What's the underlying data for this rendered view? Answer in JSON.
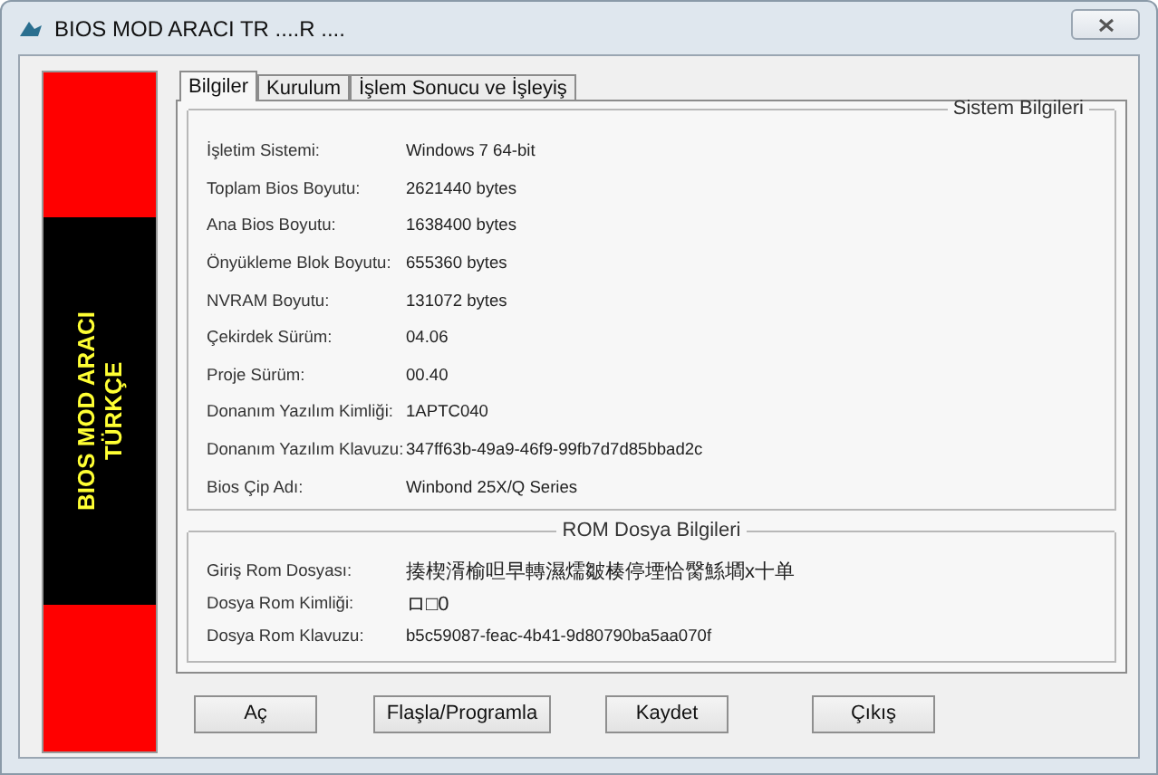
{
  "window": {
    "title": "BIOS MOD ARACI TR ....R ...."
  },
  "banner": {
    "lines": [
      "BIOS MOD ARACI",
      "TÜRKÇE"
    ]
  },
  "tabs": [
    {
      "label": "Bilgiler",
      "selected": true
    },
    {
      "label": "Kurulum",
      "selected": false
    },
    {
      "label": "İşlem Sonucu ve İşleyiş",
      "selected": false
    }
  ],
  "system_info": {
    "title": "Sistem Bilgileri",
    "rows": [
      {
        "label": "İşletim Sistemi:",
        "value": "Windows 7 64-bit"
      },
      {
        "label": "Toplam Bios Boyutu:",
        "value": "2621440 bytes"
      },
      {
        "label": "Ana Bios Boyutu:",
        "value": "1638400 bytes"
      },
      {
        "label": "Önyükleme Blok Boyutu:",
        "value": "655360 bytes"
      },
      {
        "label": "NVRAM Boyutu:",
        "value": "131072 bytes"
      },
      {
        "label": "Çekirdek Sürüm:",
        "value": "04.06"
      },
      {
        "label": "Proje Sürüm:",
        "value": "00.40"
      },
      {
        "label": "Donanım Yazılım Kimliği:",
        "value": "1APTC040"
      },
      {
        "label": "Donanım Yazılım Klavuzu:",
        "value": "347ff63b-49a9-46f9-99fb7d7d85bbad2c"
      },
      {
        "label": "Bios Çip Adı:",
        "value": "Winbond 25X/Q Series"
      }
    ]
  },
  "rom_info": {
    "title": "ROM Dosya Bilgileri",
    "rows": [
      {
        "label": "Giriş Rom Dosyası:",
        "value": "揍楔湑榆呾早轉濕燸皺楱停堙恰臋鯀墹x十单"
      },
      {
        "label": "Dosya Rom Kimliği:",
        "value": "ロ□0"
      },
      {
        "label": "Dosya Rom Klavuzu:",
        "value": "b5c59087-feac-4b41-9d80790ba5aa070f"
      }
    ]
  },
  "buttons": [
    "Aç",
    "Flaşla/Programla",
    "Kaydet",
    "Çıkış"
  ]
}
